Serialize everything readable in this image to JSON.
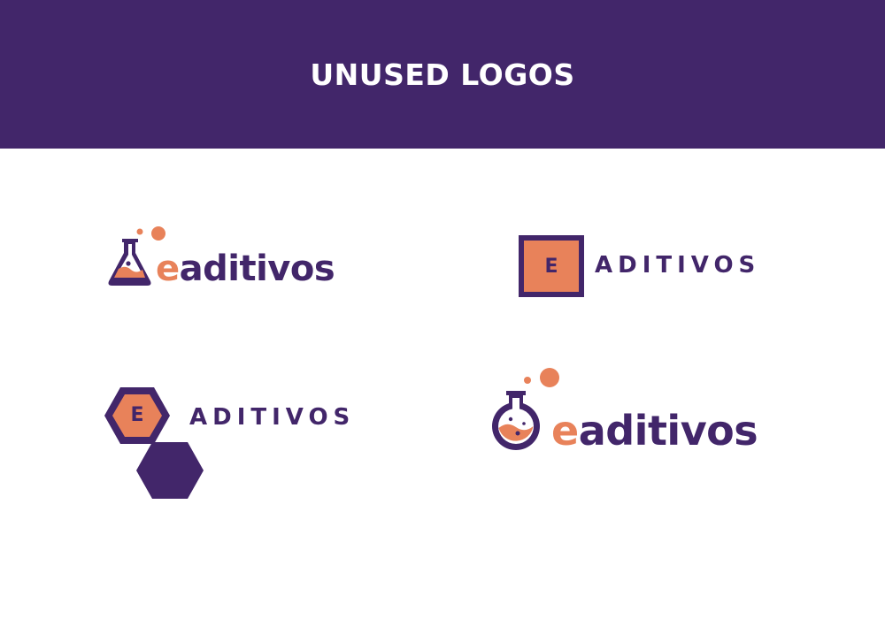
{
  "header": {
    "title": "UNUSED LOGOS"
  },
  "colors": {
    "purple": "#42266a",
    "orange": "#e8825a",
    "white": "#ffffff"
  },
  "logos": [
    {
      "variant": "flask-icon",
      "accent_letter": "e",
      "rest": "aditivos"
    },
    {
      "variant": "square-icon",
      "icon_letter": "E",
      "wordmark": "ADITIVOS"
    },
    {
      "variant": "hexagon-icon",
      "icon_letter": "E",
      "wordmark": "ADITIVOS"
    },
    {
      "variant": "round-flask-icon",
      "accent_letter": "e",
      "rest": "aditivos"
    }
  ]
}
